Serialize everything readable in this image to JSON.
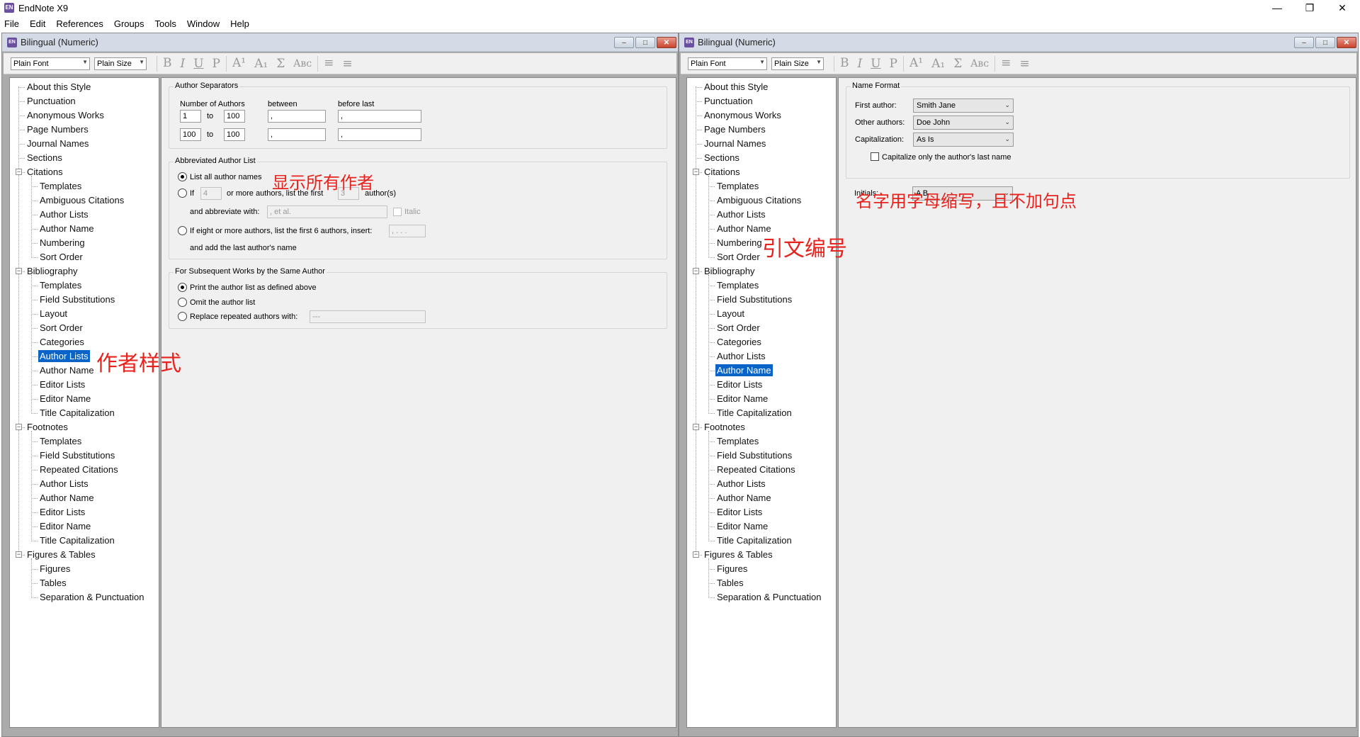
{
  "app": {
    "title": "EndNote X9",
    "logo": "EN"
  },
  "menu": [
    "File",
    "Edit",
    "References",
    "Groups",
    "Tools",
    "Window",
    "Help"
  ],
  "window_controls": [
    "minimize-icon",
    "restore-icon",
    "close-icon"
  ],
  "windows": {
    "left_title": "Bilingual (Numeric)",
    "right_title": "Bilingual (Numeric)"
  },
  "toolbar": {
    "font": "Plain Font",
    "size": "Plain Size",
    "bold": "B",
    "italic": "I",
    "underline": "U",
    "plain": "P",
    "superscript": "A¹",
    "subscript": "A₁",
    "symbol": "Σ",
    "smallcaps": "Aʙᴄ",
    "align_left": "≡",
    "justify": "≡"
  },
  "tree_items": [
    "About this Style",
    "Punctuation",
    "Anonymous Works",
    "Page Numbers",
    "Journal Names",
    "Sections",
    "Citations",
    "Templates",
    "Ambiguous Citations",
    "Author Lists",
    "Author Name",
    "Numbering",
    "Sort Order",
    "Bibliography",
    "Templates",
    "Field Substitutions",
    "Layout",
    "Sort Order",
    "Categories",
    "Author Lists",
    "Author Name",
    "Editor Lists",
    "Editor Name",
    "Title Capitalization",
    "Footnotes",
    "Templates",
    "Field Substitutions",
    "Repeated Citations",
    "Author Lists",
    "Author Name",
    "Editor Lists",
    "Editor Name",
    "Title Capitalization",
    "Figures & Tables",
    "Figures",
    "Tables",
    "Separation & Punctuation"
  ],
  "left_panel": {
    "author_separators": {
      "title": "Author Separators",
      "col_number": "Number of Authors",
      "col_between": "between",
      "col_before_last": "before last",
      "to": "to",
      "rows": [
        {
          "from": "1",
          "to": "100",
          "between": ",",
          "before_last": ","
        },
        {
          "from": "100",
          "to": "100",
          "between": ",",
          "before_last": ","
        }
      ]
    },
    "abbreviated": {
      "title": "Abbreviated Author List",
      "opt_all": "List all author names",
      "opt_if": "If",
      "if_count": "4",
      "or_more": "or more authors, list the first",
      "first_count": "3",
      "authors": "author(s)",
      "abbrev_with": "and abbreviate with:",
      "abbrev_value": ", et al.",
      "italic": "Italic",
      "opt_eight": "If eight or more authors, list the first 6 authors, insert:",
      "eight_value": ", . . .",
      "add_last": "and add the last author's name"
    },
    "subsequent": {
      "title": "For Subsequent Works by the Same Author",
      "opt_print": "Print the author list as defined above",
      "opt_omit": "Omit the author list",
      "opt_replace": "Replace repeated authors with:",
      "replace_value": "---"
    }
  },
  "right_panel": {
    "name_format": {
      "title": "Name Format",
      "first_author_label": "First author:",
      "first_author": "Smith Jane",
      "other_authors_label": "Other authors:",
      "other_authors": "Doe John",
      "capitalization_label": "Capitalization:",
      "capitalization": "As Is",
      "capitalize_only": "Capitalize only the author's last name",
      "initials_label": "Initials:",
      "initials": "A B"
    }
  },
  "annotations": {
    "show_all": "显示所有作者",
    "author_style": "作者样式",
    "initials_note": "名字用字母缩写，且不加句点",
    "numbering_note": "引文编号"
  }
}
